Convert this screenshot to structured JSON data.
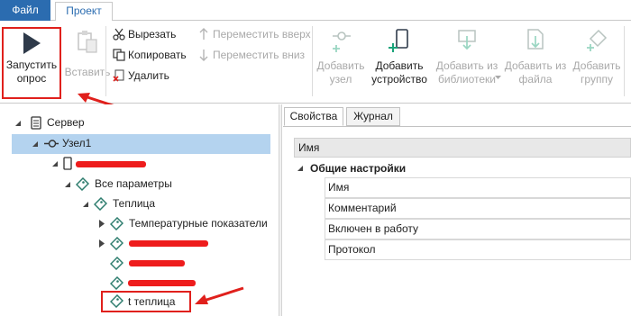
{
  "tabs": {
    "file": "Файл",
    "project": "Проект"
  },
  "ribbon": {
    "start_poll": {
      "line1": "Запустить",
      "line2": "опрос"
    },
    "paste": "Вставить",
    "cut": "Вырезать",
    "copy": "Копировать",
    "delete": "Удалить",
    "move_up": "Переместить вверх",
    "move_down": "Переместить вниз",
    "add_node": {
      "line1": "Добавить",
      "line2": "узел"
    },
    "add_device": {
      "line1": "Добавить",
      "line2": "устройство"
    },
    "add_from_library": {
      "line1": "Добавить из",
      "line2": "библиотеки"
    },
    "add_from_file": {
      "line1": "Добавить из",
      "line2": "файла"
    },
    "add_group": {
      "line1": "Добавить",
      "line2": "группу"
    }
  },
  "tree": {
    "server": "Сервер",
    "node1": "Узел1",
    "all_params": "Все параметры",
    "greenhouse": "Теплица",
    "temperature": "Температурные показатели",
    "t_greenhouse": "t теплица"
  },
  "right_panel": {
    "tabs": [
      "Свойства",
      "Журнал"
    ],
    "header": "Имя",
    "group": "Общие настройки",
    "rows": [
      "Имя",
      "Комментарий",
      "Включен в работу",
      "Протокол"
    ]
  },
  "colors": {
    "accent": "#2b6cb0",
    "selection": "#b4d3ef",
    "annotation": "#e0201c",
    "disabled_text": "#a9a9a9"
  }
}
